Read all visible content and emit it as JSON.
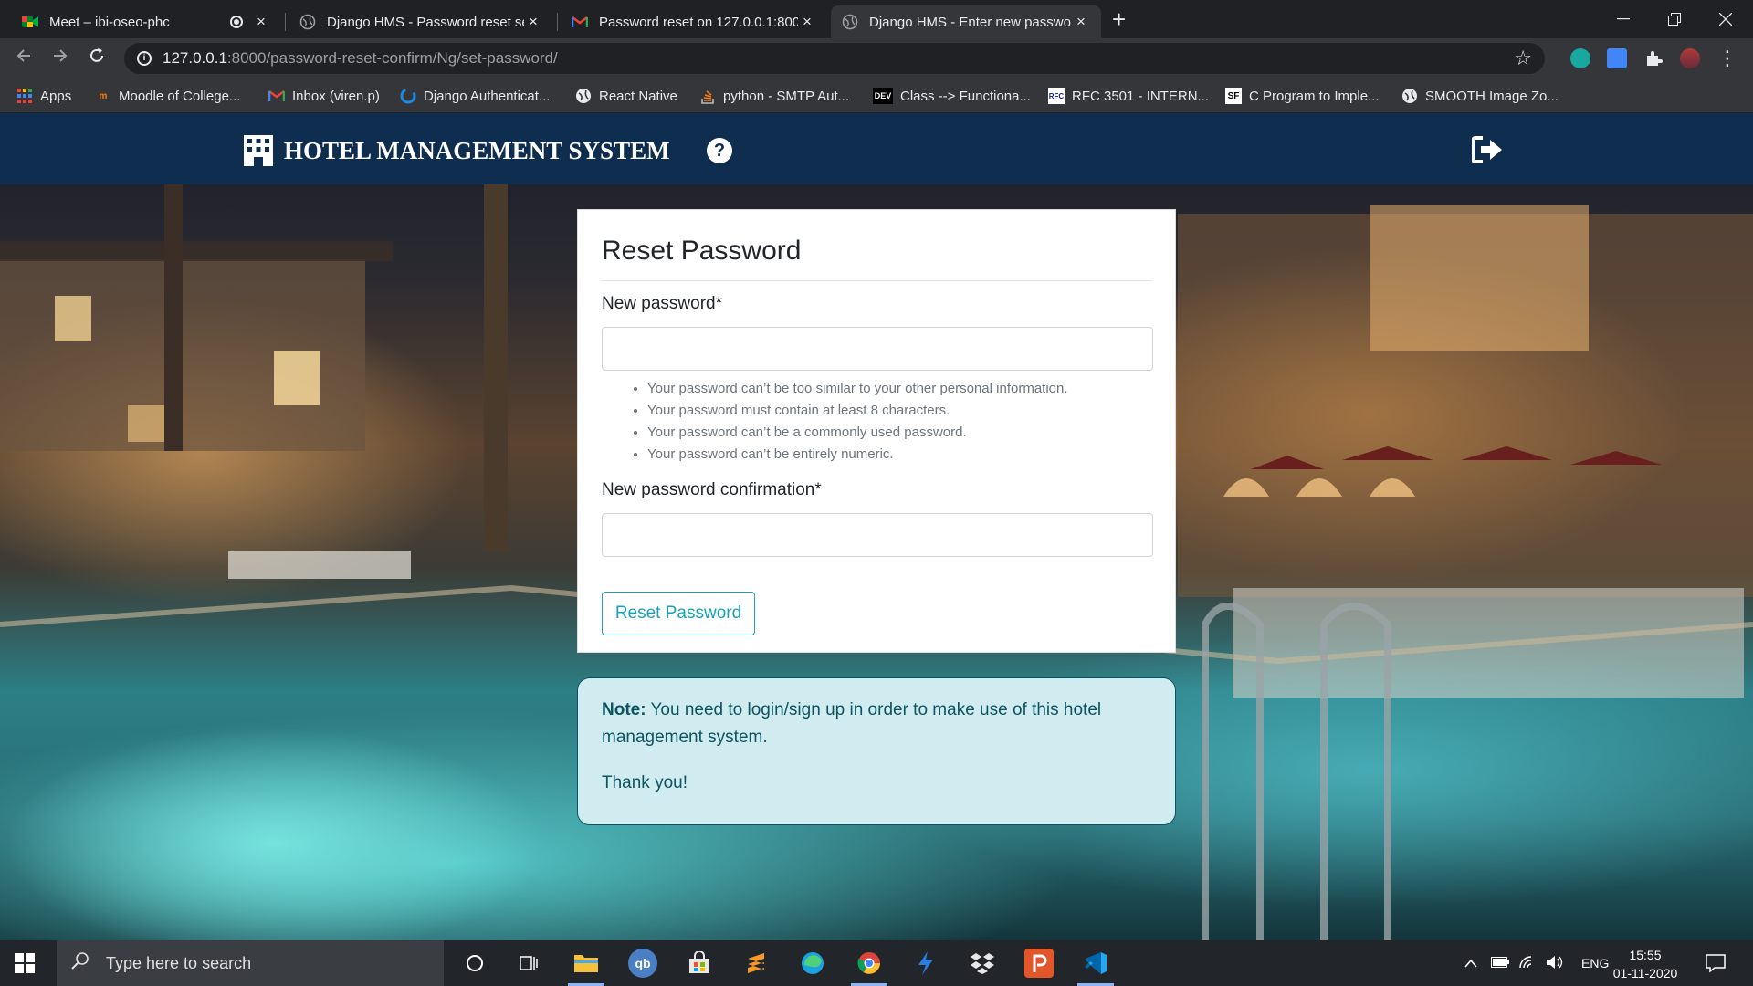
{
  "browser": {
    "tabs": [
      {
        "title": "Meet – ibi-oseo-phc",
        "close": "×"
      },
      {
        "title": "Django HMS - Password reset se",
        "close": "×"
      },
      {
        "title": "Password reset on 127.0.0.1:8000",
        "close": "×"
      },
      {
        "title": "Django HMS - Enter new passwo",
        "close": "×"
      }
    ],
    "new_tab": "+",
    "url_host": "127.0.0.1",
    "url_rest": ":8000/password-reset-confirm/Ng/set-password/",
    "bookmarks": [
      {
        "label": "Apps",
        "icon": "apps-grid-icon"
      },
      {
        "label": "Moodle of College...",
        "icon": "moodle-icon"
      },
      {
        "label": "Inbox (viren.p)",
        "icon": "gmail-icon"
      },
      {
        "label": "Django Authenticat...",
        "icon": "auth0-icon"
      },
      {
        "label": "React Native",
        "icon": "globe-icon"
      },
      {
        "label": "python - SMTP Aut...",
        "icon": "stackoverflow-icon"
      },
      {
        "label": "Class --> Functiona...",
        "icon": "dev-icon"
      },
      {
        "label": "RFC 3501 - INTERN...",
        "icon": "rfc-icon"
      },
      {
        "label": "C Program to Imple...",
        "icon": "sf-icon"
      },
      {
        "label": "SMOOTH Image Zo...",
        "icon": "globe-icon"
      }
    ],
    "dev_badge": "DEV",
    "sf_badge": "SF",
    "rfc_badge": "RFC"
  },
  "navbar": {
    "brand": "HOTEL MANAGEMENT SYSTEM",
    "help": "?"
  },
  "form": {
    "title": "Reset Password",
    "new_password_label": "New password*",
    "help_texts": [
      "Your password can’t be too similar to your other personal information.",
      "Your password must contain at least 8 characters.",
      "Your password can’t be a commonly used password.",
      "Your password can’t be entirely numeric."
    ],
    "confirm_label": "New password confirmation*",
    "submit": "Reset Password"
  },
  "note": {
    "bold": "Note:",
    "text": " You need to login/sign up in order to make use of this hotel management system.",
    "thanks": "Thank you!"
  },
  "taskbar": {
    "search_placeholder": "Type here to search",
    "qb": "qb",
    "lang": "ENG",
    "time": "15:55",
    "date": "01-11-2020"
  },
  "colors": {
    "navbar": "#0f2d4e",
    "accent": "#17a2b8",
    "note_bg": "#d1ecf1",
    "note_text": "#0c5460"
  }
}
